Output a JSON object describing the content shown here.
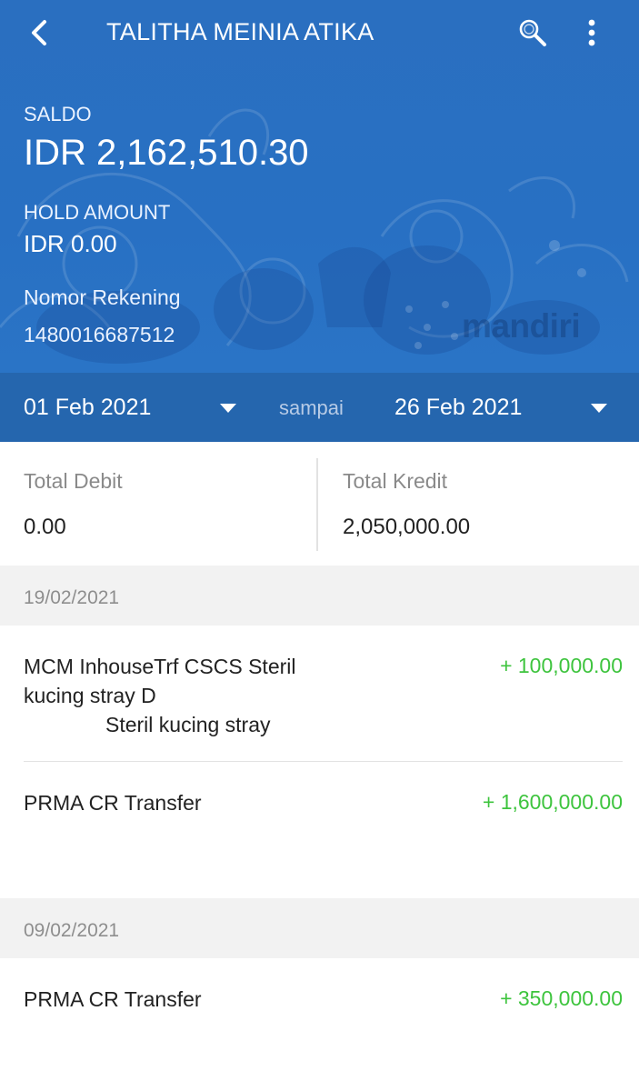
{
  "header": {
    "title": "TALITHA MEINIA ATIKA",
    "icons": {
      "back": "back-arrow-icon",
      "search": "search-icon",
      "menu": "more-vertical-icon"
    },
    "brand": "mandiri"
  },
  "account": {
    "saldo_label": "SALDO",
    "saldo_value": "IDR 2,162,510.30",
    "hold_label": "HOLD AMOUNT",
    "hold_value": "IDR 0.00",
    "rekening_label": "Nomor Rekening",
    "rekening_value": "1480016687512"
  },
  "date_range": {
    "from": "01 Feb 2021",
    "separator": "sampai",
    "to": "26 Feb 2021"
  },
  "totals": {
    "debit_label": "Total Debit",
    "debit_value": "0.00",
    "kredit_label": "Total Kredit",
    "kredit_value": "2,050,000.00"
  },
  "groups": [
    {
      "date": "19/02/2021",
      "transactions": [
        {
          "desc_lines": [
            "MCM InhouseTrf CSCS Steril",
            "kucing stray D",
            "Steril kucing stray"
          ],
          "amount": "+ 100,000.00"
        },
        {
          "desc_lines": [
            "PRMA CR Transfer"
          ],
          "amount": "+ 1,600,000.00"
        }
      ]
    },
    {
      "date": "09/02/2021",
      "transactions": [
        {
          "desc_lines": [
            "PRMA CR Transfer"
          ],
          "amount": "+ 350,000.00"
        }
      ]
    }
  ],
  "colors": {
    "header_blue": "#2a6fc0",
    "datebar_blue": "#2566ae",
    "credit_green": "#3ec43e"
  }
}
